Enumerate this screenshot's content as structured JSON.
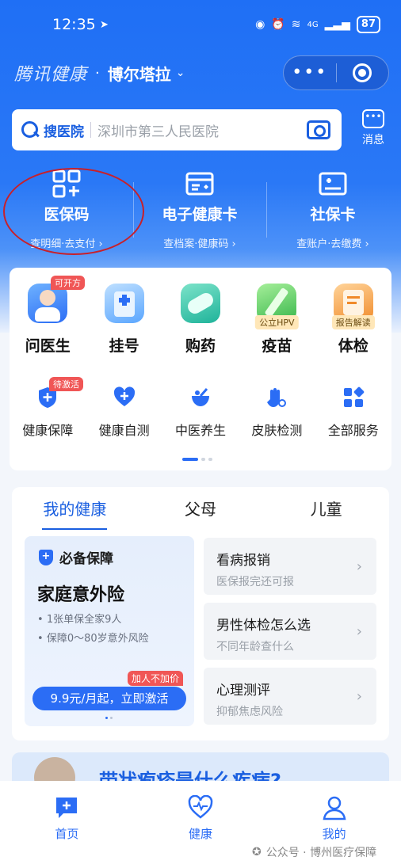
{
  "status_bar": {
    "time": "12:35",
    "network": "4G",
    "battery": "87"
  },
  "header": {
    "app_name": "腾讯健康",
    "separator": "·",
    "city": "博尔塔拉"
  },
  "search": {
    "keyword": "搜医院",
    "placeholder": "深圳市第三人民医院"
  },
  "message": {
    "label": "消息"
  },
  "quick": [
    {
      "title": "医保码",
      "sub": "查明细·去支付 ›"
    },
    {
      "title": "电子健康卡",
      "sub": "查档案·健康码 ›"
    },
    {
      "title": "社保卡",
      "sub": "查账户·去缴费 ›"
    }
  ],
  "services_row1": [
    {
      "name": "问医生",
      "badge": "可开方"
    },
    {
      "name": "挂号"
    },
    {
      "name": "购药"
    },
    {
      "name": "疫苗",
      "tag": "公立HPV"
    },
    {
      "name": "体检",
      "tag": "报告解读"
    }
  ],
  "services_row2": [
    {
      "name": "健康保障",
      "badge": "待激活"
    },
    {
      "name": "健康自测"
    },
    {
      "name": "中医养生"
    },
    {
      "name": "皮肤检测"
    },
    {
      "name": "全部服务"
    }
  ],
  "health": {
    "tabs": [
      "我的健康",
      "父母",
      "儿童"
    ],
    "promo": {
      "header": "必备保障",
      "title": "家庭意外险",
      "bullets": [
        "1张单保全家9人",
        "保障0～80岁意外风险"
      ],
      "flag": "加人不加价",
      "button": "9.9元/月起，立即激活"
    },
    "cards": [
      {
        "title": "看病报销",
        "sub": "医保报完还可报"
      },
      {
        "title": "男性体检怎么选",
        "sub": "不同年龄查什么"
      },
      {
        "title": "心理测评",
        "sub": "抑郁焦虑风险"
      }
    ]
  },
  "banner": {
    "text": "带状疱疹是什么疾病?"
  },
  "nav": [
    {
      "label": "首页"
    },
    {
      "label": "健康"
    },
    {
      "label": "我的"
    }
  ],
  "watermark": "公众号 · 博州医疗保障",
  "colors": {
    "primary": "#2b6df5",
    "badge_red": "#f05656",
    "annotation_red": "#c8202a"
  }
}
